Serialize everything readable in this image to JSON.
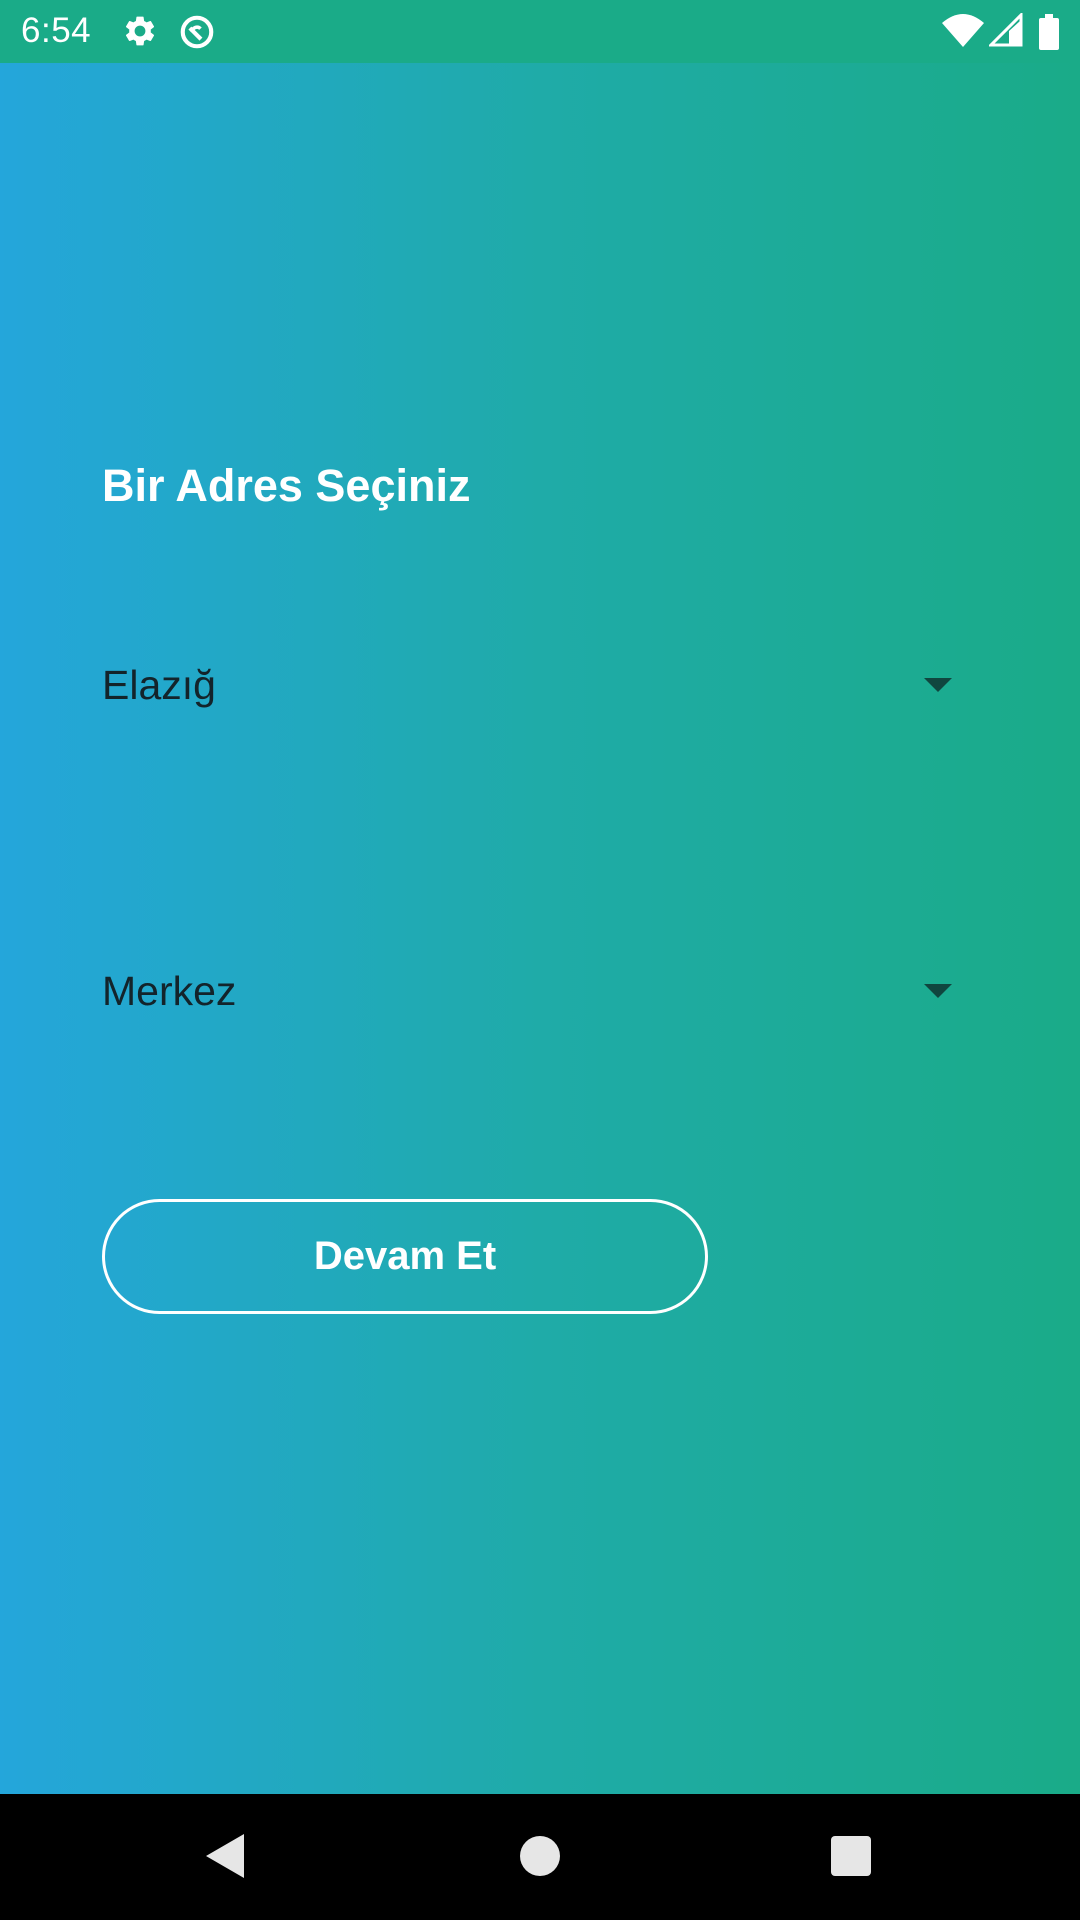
{
  "status_bar": {
    "time": "6:54",
    "background_color": "#1aab88",
    "icons": [
      "gear-icon",
      "sync-icon",
      "wifi-icon",
      "cell-signal-icon",
      "battery-icon"
    ]
  },
  "main": {
    "title": "Bir Adres Seçiniz",
    "city_dropdown": {
      "selected": "Elazığ"
    },
    "district_dropdown": {
      "selected": "Merkez"
    },
    "continue_button": {
      "label": "Devam Et"
    },
    "gradient": {
      "start": "#24a6db",
      "end": "#1aab88"
    }
  },
  "nav_bar": {
    "buttons": [
      "back-icon",
      "home-icon",
      "recents-icon"
    ]
  }
}
